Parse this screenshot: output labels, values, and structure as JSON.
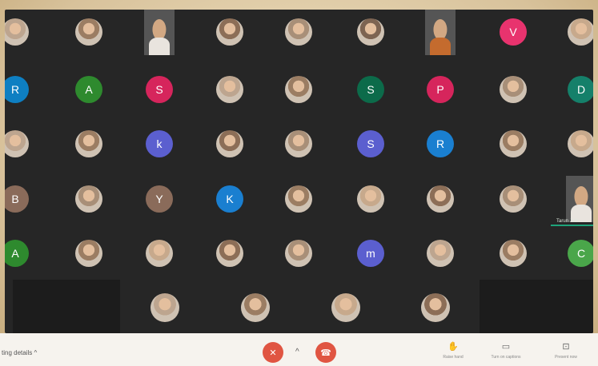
{
  "speaker_name": "Tarun Jain",
  "bottom": {
    "meeting_details": "ting details",
    "chevron": "^",
    "controls": [
      {
        "label": "Raise hand",
        "icon": "✋"
      },
      {
        "label": "Turn on captions",
        "icon": "▭"
      },
      {
        "label": "Present now",
        "icon": "⊡"
      }
    ]
  },
  "rows": [
    [
      {
        "type": "photo"
      },
      {
        "type": "photo"
      },
      {
        "type": "video"
      },
      {
        "type": "photo"
      },
      {
        "type": "photo"
      },
      {
        "type": "photo"
      },
      {
        "type": "video"
      },
      {
        "type": "letter",
        "letter": "V",
        "color": "#e8336e"
      },
      {
        "type": "photo"
      }
    ],
    [
      {
        "type": "letter",
        "letter": "R",
        "color": "#0e7fc2"
      },
      {
        "type": "letter",
        "letter": "A",
        "color": "#2e8a2e"
      },
      {
        "type": "letter",
        "letter": "S",
        "color": "#d6255c"
      },
      {
        "type": "photo"
      },
      {
        "type": "photo"
      },
      {
        "type": "letter",
        "letter": "S",
        "color": "#0c6b4a"
      },
      {
        "type": "letter",
        "letter": "P",
        "color": "#d6255c"
      },
      {
        "type": "photo"
      },
      {
        "type": "letter",
        "letter": "D",
        "color": "#15806a"
      }
    ],
    [
      {
        "type": "photo"
      },
      {
        "type": "photo"
      },
      {
        "type": "letter",
        "letter": "k",
        "color": "#5b5fcf"
      },
      {
        "type": "photo"
      },
      {
        "type": "photo"
      },
      {
        "type": "letter",
        "letter": "S",
        "color": "#5b5fcf"
      },
      {
        "type": "letter",
        "letter": "R",
        "color": "#1a7fd0"
      },
      {
        "type": "photo"
      },
      {
        "type": "photo"
      }
    ],
    [
      {
        "type": "letter",
        "letter": "B",
        "color": "#8a6b5a"
      },
      {
        "type": "photo"
      },
      {
        "type": "letter",
        "letter": "Y",
        "color": "#8a6b5a"
      },
      {
        "type": "letter",
        "letter": "K",
        "color": "#1a7fd0"
      },
      {
        "type": "photo"
      },
      {
        "type": "photo"
      },
      {
        "type": "photo"
      },
      {
        "type": "photo"
      },
      {
        "type": "video"
      }
    ],
    [
      {
        "type": "letter",
        "letter": "A",
        "color": "#2e8a2e"
      },
      {
        "type": "photo"
      },
      {
        "type": "photo"
      },
      {
        "type": "photo"
      },
      {
        "type": "photo"
      },
      {
        "type": "letter",
        "letter": "m",
        "color": "#5b5fcf"
      },
      {
        "type": "photo"
      },
      {
        "type": "photo"
      },
      {
        "type": "letter",
        "letter": "C",
        "color": "#4aa64a"
      }
    ],
    [
      {
        "type": "empty"
      },
      {
        "type": "photo"
      },
      {
        "type": "photo"
      },
      {
        "type": "photo"
      },
      {
        "type": "photo"
      },
      {
        "type": "empty"
      }
    ]
  ]
}
